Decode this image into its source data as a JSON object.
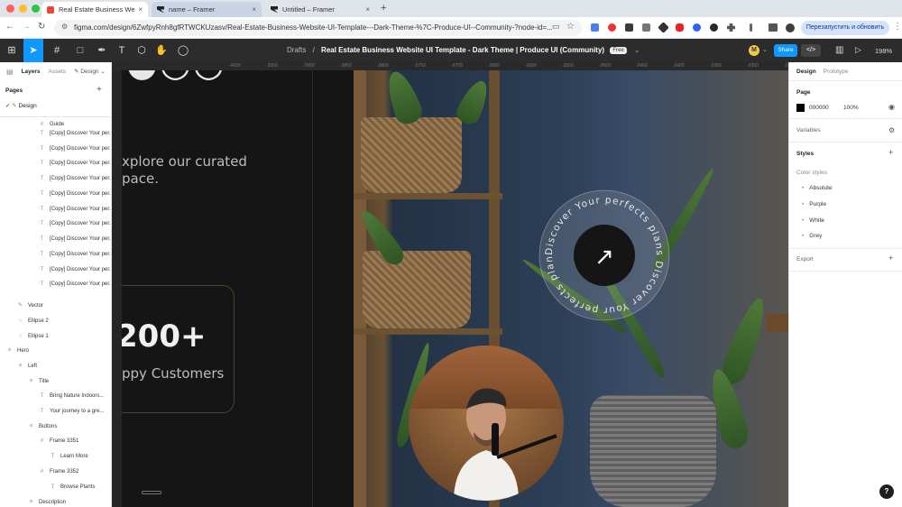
{
  "browser": {
    "tabs": [
      {
        "label": "Real Estate Business Website",
        "close": "×"
      },
      {
        "label": "name – Framer",
        "close": "×"
      },
      {
        "label": "Untitled – Framer",
        "close": "×"
      }
    ],
    "new_tab": "+",
    "url": "figma.com/design/6ZwfpyRnh8gfRTWCKUzasv/Real-Estate-Business-Website-UI-Template---Dark-Theme-%7C-Produce-UI--Community-?node-id=...",
    "relaunch_label": "Перезапустить и обновить",
    "colors": {
      "close": "#ff5f57",
      "min": "#febc2e",
      "max": "#28c840"
    }
  },
  "toolbar": {
    "crumb_root": "Drafts",
    "crumb_sep": "/",
    "file_title": "Real Estate Business Website UI Template - Dark Theme | Produce UI (Community)",
    "free_badge": "Free",
    "avatar_initial": "M",
    "share_label": "Share",
    "dev_label": "</>",
    "zoom": "198%"
  },
  "left_panel": {
    "tab_layers": "Layers",
    "tab_assets": "Assets",
    "tab_design": "Design",
    "pages_heading": "Pages",
    "page_current": "Design",
    "layers": [
      {
        "label": "Guide",
        "icon": "#"
      },
      {
        "label": "[Copy] Discover Your per...",
        "icon": "T"
      },
      {
        "label": "[Copy] Discover Your per...",
        "icon": "T"
      },
      {
        "label": "[Copy] Discover Your per...",
        "icon": "T"
      },
      {
        "label": "[Copy] Discover Your per...",
        "icon": "T"
      },
      {
        "label": "[Copy] Discover Your per...",
        "icon": "T"
      },
      {
        "label": "[Copy] Discover Your per...",
        "icon": "T"
      },
      {
        "label": "[Copy] Discover Your per...",
        "icon": "T"
      },
      {
        "label": "[Copy] Discover Your per...",
        "icon": "T"
      },
      {
        "label": "[Copy] Discover Your per...",
        "icon": "T"
      },
      {
        "label": "[Copy] Discover Your per...",
        "icon": "T"
      },
      {
        "label": "[Copy] Discover Your per...",
        "icon": "T"
      },
      {
        "label": "Vector",
        "icon": "✎"
      },
      {
        "label": "Ellipse 2",
        "icon": "○"
      },
      {
        "label": "Ellipse 1",
        "icon": "○"
      },
      {
        "label": "Hero",
        "icon": "≡"
      },
      {
        "label": "Left",
        "icon": "≡"
      },
      {
        "label": "Title",
        "icon": "≡"
      },
      {
        "label": "Bring Nature Indoors...",
        "icon": "T"
      },
      {
        "label": "Your journey to a gre...",
        "icon": "T"
      },
      {
        "label": "Buttons",
        "icon": "≡"
      },
      {
        "label": "Frame 3351",
        "icon": "#"
      },
      {
        "label": "Learn More",
        "icon": "T"
      },
      {
        "label": "Frame 3352",
        "icon": "#"
      },
      {
        "label": "Browse Plants",
        "icon": "T"
      },
      {
        "label": "Description",
        "icon": "≡"
      }
    ]
  },
  "canvas": {
    "ruler_marks": [
      "-4000",
      "-3950",
      "-3900",
      "-3850",
      "-3800",
      "-3750",
      "-3700",
      "-3650",
      "-3600",
      "-3550",
      "-3500",
      "-3450",
      "-3400",
      "-3350",
      "-3300",
      "-3250",
      "-3200",
      "-3150"
    ],
    "explore_line1": "xplore our curated",
    "explore_line2": "pace.",
    "big_number": "200+",
    "customers_label": "ppy Customers",
    "badge_text": "Discover Your perfects plans Discover Your perfects plans",
    "badge_arrow": "↗"
  },
  "right_panel": {
    "tab_design": "Design",
    "tab_prototype": "Prototype",
    "page_heading": "Page",
    "page_color": "000000",
    "page_opacity": "100%",
    "variables_label": "Variables",
    "styles_heading": "Styles",
    "color_styles_label": "Color styles",
    "color_styles": [
      "Absolute",
      "Purple",
      "White",
      "Grey"
    ],
    "export_label": "Export",
    "help": "?"
  }
}
